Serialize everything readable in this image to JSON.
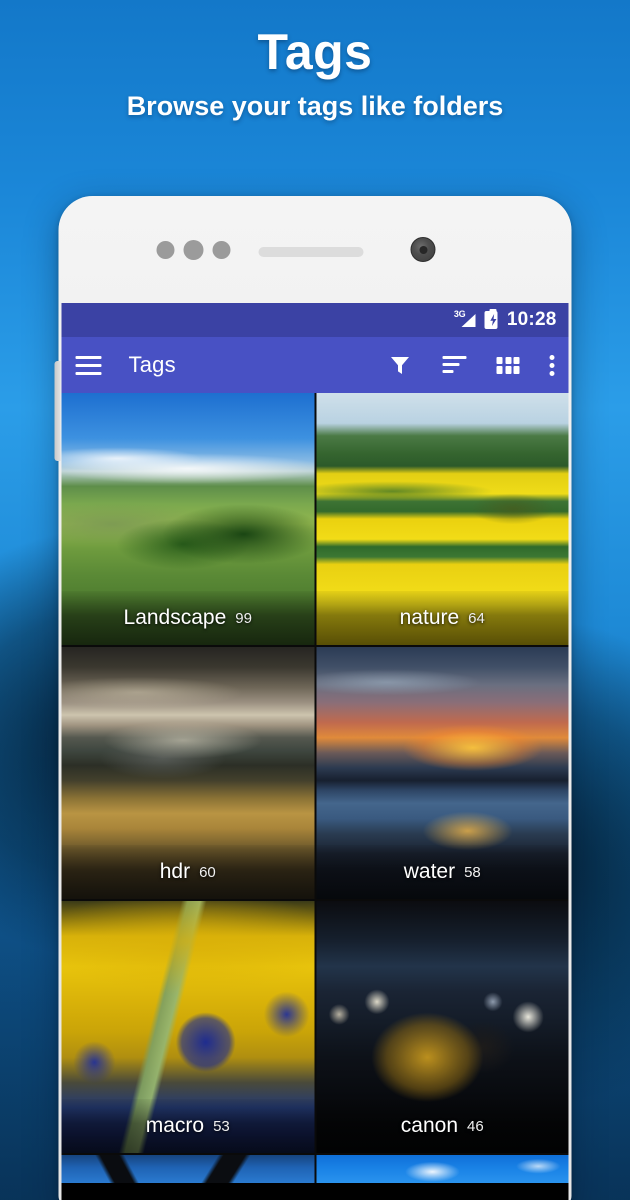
{
  "promo": {
    "title": "Tags",
    "subtitle": "Browse your tags like folders",
    "bg_top_color": "#1b87d8",
    "bg_bottom_color": "#0b3f6d"
  },
  "device": {
    "body_color": "#efefef",
    "front_camera": "front-camera",
    "speaker": "earpiece-speaker",
    "sensors": "proximity-sensors"
  },
  "status_bar": {
    "network_label": "3G",
    "signal_icon": "signal-bars-icon",
    "battery_icon": "battery-charging-icon",
    "time": "10:28",
    "background": "#3b42a4"
  },
  "app_bar": {
    "menu_icon": "hamburger-menu-icon",
    "title": "Tags",
    "background": "#4851c4",
    "actions": [
      {
        "name": "filter",
        "icon": "filter-funnel-icon",
        "label": "Filter"
      },
      {
        "name": "sort",
        "icon": "sort-lines-icon",
        "label": "Sort"
      },
      {
        "name": "view-mode",
        "icon": "grid-view-icon",
        "label": "Grid view"
      },
      {
        "name": "overflow",
        "icon": "overflow-menu-icon",
        "label": "More options"
      }
    ]
  },
  "tags": [
    {
      "name": "Landscape",
      "count": "99",
      "art": "art-landscape",
      "thumb": "green-hills-landscape"
    },
    {
      "name": "nature",
      "count": "64",
      "art": "art-nature",
      "thumb": "yellow-rapeseed-field"
    },
    {
      "name": "hdr",
      "count": "60",
      "art": "art-hdr",
      "thumb": "stormy-mountain-hdr"
    },
    {
      "name": "water",
      "count": "58",
      "art": "art-water",
      "thumb": "sunset-lake-reflection"
    },
    {
      "name": "macro",
      "count": "53",
      "art": "art-macro",
      "thumb": "dew-drops-on-stem"
    },
    {
      "name": "canon",
      "count": "46",
      "art": "art-canon",
      "thumb": "dslr-camera-at-night"
    }
  ],
  "partial_row": [
    {
      "art": "art-arch",
      "thumb": "architecture-against-sky"
    },
    {
      "art": "art-sky",
      "thumb": "blue-sky-with-clouds"
    }
  ]
}
